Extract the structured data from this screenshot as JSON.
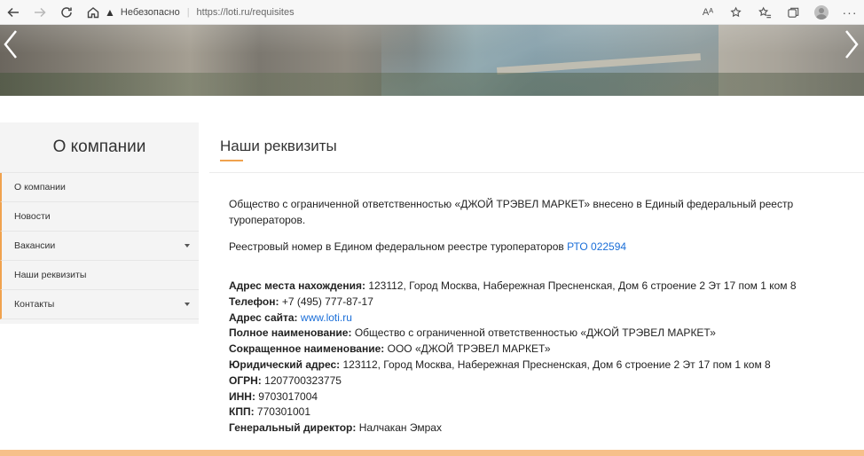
{
  "browser": {
    "security_label": "Небезопасно",
    "url": "https://loti.ru/requisites",
    "reader_label": "Aᴬ"
  },
  "sidebar": {
    "title": "О компании",
    "items": [
      {
        "label": "О компании",
        "has_dropdown": false
      },
      {
        "label": "Новости",
        "has_dropdown": false
      },
      {
        "label": "Вакансии",
        "has_dropdown": true
      },
      {
        "label": "Наши реквизиты",
        "has_dropdown": false
      },
      {
        "label": "Контакты",
        "has_dropdown": true
      }
    ]
  },
  "main": {
    "title": "Наши реквизиты",
    "intro": "Общество с ограниченной ответственностью «ДЖОЙ ТРЭВЕЛ МАРКЕТ» внесено в Единый федеральный реестр туроператоров.",
    "registry_text": "Реестровый номер в Едином федеральном реестре туроператоров",
    "registry_number": "РТО 022594",
    "details": [
      {
        "label": "Адрес места нахождения:",
        "value": "123112, Город Москва, Набережная Пресненская, Дом 6 строение 2 Эт 17 пом 1 ком 8"
      },
      {
        "label": "Телефон:",
        "value": "+7 (495) 777-87-17"
      },
      {
        "label": "Адрес сайта:",
        "value": "www.loti.ru",
        "is_link": true
      },
      {
        "label": "Полное наименование:",
        "value": "Общество с ограниченной ответственностью «ДЖОЙ ТРЭВЕЛ МАРКЕТ»"
      },
      {
        "label": "Сокращенное наименование:",
        "value": "ООО «ДЖОЙ ТРЭВЕЛ МАРКЕТ»"
      },
      {
        "label": "Юридический адрес:",
        "value": "123112, Город Москва, Набережная Пресненская, Дом 6 строение 2 Эт 17 пом 1 ком 8"
      },
      {
        "label": "ОГРН:",
        "value": "1207700323775"
      },
      {
        "label": "ИНН:",
        "value": "9703017004"
      },
      {
        "label": "КПП:",
        "value": "770301001"
      },
      {
        "label": "Генеральный директор:",
        "value": "Налчакан Эмрах"
      }
    ]
  },
  "colors": {
    "accent": "#f0a24e",
    "link": "#1a6ed8",
    "bottom_bar": "#f6c08a"
  }
}
